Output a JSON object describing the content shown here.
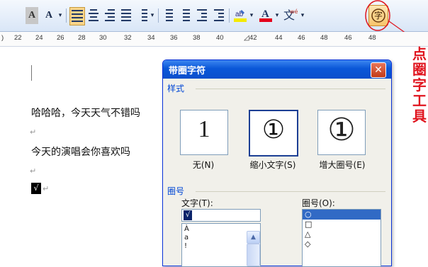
{
  "toolbar": {
    "buttons": [
      "A",
      "A",
      "▾",
      "▾",
      "▾",
      "▾",
      "▾"
    ],
    "enclose_char_label": "字"
  },
  "ruler": {
    "ticks": [
      "22",
      "24",
      "26",
      "28",
      "30",
      "32",
      "34",
      "36",
      "38",
      "40",
      "42",
      "44",
      "46",
      "48"
    ]
  },
  "document": {
    "line1": "哈哈哈，今天天气不错吗",
    "line2": "今天的演唱会你喜欢吗",
    "checkmark": "√",
    "para_mark": "↵"
  },
  "annotation": {
    "chars": [
      "点",
      "圈",
      "字",
      "工",
      "具"
    ]
  },
  "dialog": {
    "title": "带圈字符",
    "close": "✕",
    "style_group": "样式",
    "styles": [
      {
        "glyph": "1",
        "label": "无(N)"
      },
      {
        "glyph": "①",
        "label": "缩小文字(S)"
      },
      {
        "glyph": "①",
        "label": "增大圈号(E)"
      }
    ],
    "enclosure_group": "圈号",
    "text_label": "文字(T):",
    "text_value": "√",
    "text_list": [
      "À",
      "a",
      "!"
    ],
    "enclosure_label": "圈号(O):",
    "enclosure_list": [
      "○",
      "□",
      "△",
      "◇"
    ]
  },
  "colors": {
    "accent": "#0a57d8",
    "annotation": "#e0141e"
  }
}
